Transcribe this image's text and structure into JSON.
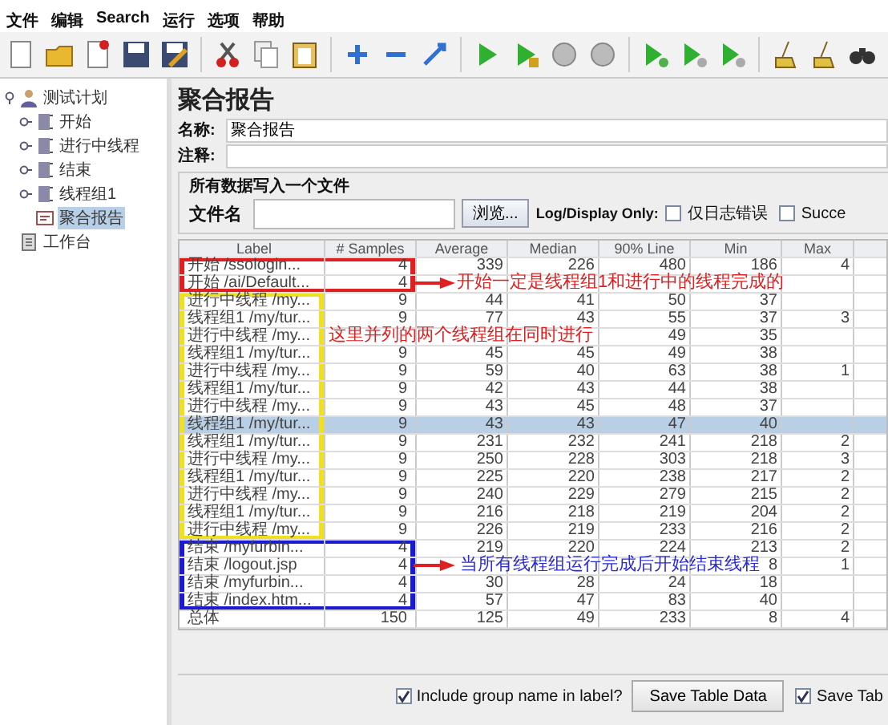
{
  "menu": [
    "文件",
    "编辑",
    "Search",
    "运行",
    "选项",
    "帮助"
  ],
  "tree": {
    "label": "测试计划",
    "expanded": true,
    "children": [
      {
        "label": "开始",
        "kind": "group",
        "selected": false
      },
      {
        "label": "进行中线程",
        "kind": "group",
        "selected": false
      },
      {
        "label": "结束",
        "kind": "group",
        "selected": false
      },
      {
        "label": "线程组1",
        "kind": "group",
        "selected": false
      },
      {
        "label": "聚合报告",
        "kind": "report",
        "selected": true
      }
    ]
  },
  "workbench": "工作台",
  "panel": {
    "title": "聚合报告",
    "name_label": "名称:",
    "name_value": "聚合报告",
    "comment_label": "注释:",
    "file_group": "所有数据写入一个文件",
    "file_label": "文件名",
    "browse": "浏览...",
    "log_label": "Log/Display Only:",
    "checks": [
      {
        "label": "仅日志错误",
        "checked": false
      },
      {
        "label": "Succe",
        "checked": false
      }
    ]
  },
  "table": {
    "columns": [
      "Label",
      "# Samples",
      "Average",
      "Median",
      "90% Line",
      "Min",
      "Max"
    ],
    "rows": [
      {
        "cells": [
          "开始 /ssologin...",
          "4",
          "339",
          "226",
          "480",
          "186",
          "4"
        ],
        "selected": false,
        "frame": {
          "color": "#e02020",
          "wide": true
        }
      },
      {
        "cells": [
          "开始 /ai/Default...",
          "4",
          null,
          null,
          null,
          null,
          null
        ],
        "selected": false,
        "frame": {
          "color": "#e02020",
          "wide": true
        }
      },
      {
        "cells": [
          "进行中线程 /my...",
          "9",
          "44",
          "41",
          "50",
          "37",
          null
        ],
        "selected": false,
        "frame": {
          "color": "#f0e020",
          "wide": false
        }
      },
      {
        "cells": [
          "线程组1 /my/tur...",
          "9",
          "77",
          "43",
          "55",
          "37",
          "3"
        ],
        "selected": false,
        "frame": {
          "color": "#f0e020",
          "wide": false
        }
      },
      {
        "cells": [
          "进行中线程 /my...",
          null,
          null,
          null,
          "49",
          "35",
          null
        ],
        "selected": false,
        "frame": {
          "color": "#f0e020",
          "wide": false
        }
      },
      {
        "cells": [
          "线程组1 /my/tur...",
          "9",
          "45",
          "45",
          "49",
          "38",
          null
        ],
        "selected": false,
        "frame": {
          "color": "#f0e020",
          "wide": false
        }
      },
      {
        "cells": [
          "进行中线程 /my...",
          "9",
          "59",
          "40",
          "63",
          "38",
          "1"
        ],
        "selected": false,
        "frame": {
          "color": "#f0e020",
          "wide": false
        }
      },
      {
        "cells": [
          "线程组1 /my/tur...",
          "9",
          "42",
          "43",
          "44",
          "38",
          null
        ],
        "selected": false,
        "frame": {
          "color": "#f0e020",
          "wide": false
        }
      },
      {
        "cells": [
          "进行中线程 /my...",
          "9",
          "43",
          "45",
          "48",
          "37",
          null
        ],
        "selected": false,
        "frame": {
          "color": "#f0e020",
          "wide": false
        }
      },
      {
        "cells": [
          "线程组1 /my/tur...",
          "9",
          "43",
          "43",
          "47",
          "40",
          null
        ],
        "selected": true,
        "frame": {
          "color": "#f0e020",
          "wide": false
        }
      },
      {
        "cells": [
          "线程组1 /my/tur...",
          "9",
          "231",
          "232",
          "241",
          "218",
          "2"
        ],
        "selected": false,
        "frame": {
          "color": "#f0e020",
          "wide": false
        }
      },
      {
        "cells": [
          "进行中线程 /my...",
          "9",
          "250",
          "228",
          "303",
          "218",
          "3"
        ],
        "selected": false,
        "frame": {
          "color": "#f0e020",
          "wide": false
        }
      },
      {
        "cells": [
          "线程组1 /my/tur...",
          "9",
          "225",
          "220",
          "238",
          "217",
          "2"
        ],
        "selected": false,
        "frame": {
          "color": "#f0e020",
          "wide": false
        }
      },
      {
        "cells": [
          "进行中线程 /my...",
          "9",
          "240",
          "229",
          "279",
          "215",
          "2"
        ],
        "selected": false,
        "frame": {
          "color": "#f0e020",
          "wide": false
        }
      },
      {
        "cells": [
          "线程组1 /my/tur...",
          "9",
          "216",
          "218",
          "219",
          "204",
          "2"
        ],
        "selected": false,
        "frame": {
          "color": "#f0e020",
          "wide": false
        }
      },
      {
        "cells": [
          "进行中线程 /my...",
          "9",
          "226",
          "219",
          "233",
          "216",
          "2"
        ],
        "selected": false,
        "frame": {
          "color": "#f0e020",
          "wide": false
        }
      },
      {
        "cells": [
          "结束 /myfurbin...",
          "4",
          "219",
          "220",
          "224",
          "213",
          "2"
        ],
        "selected": false,
        "frame": {
          "color": "#1a1ad0",
          "wide": true
        }
      },
      {
        "cells": [
          "结束 /logout.jsp",
          "4",
          null,
          null,
          null,
          "8",
          "1"
        ],
        "selected": false,
        "frame": {
          "color": "#1a1ad0",
          "wide": true
        }
      },
      {
        "cells": [
          "结束 /myfurbin...",
          "4",
          "30",
          "28",
          "24",
          "18",
          null
        ],
        "selected": false,
        "frame": {
          "color": "#1a1ad0",
          "wide": true
        }
      },
      {
        "cells": [
          "结束 /index.htm...",
          "4",
          "57",
          "47",
          "83",
          "40",
          null
        ],
        "selected": false,
        "frame": {
          "color": "#1a1ad0",
          "wide": true
        }
      },
      {
        "cells": [
          "总体",
          "150",
          "125",
          "49",
          "233",
          "8",
          "4"
        ],
        "selected": false
      }
    ]
  },
  "bottom": {
    "include_group": {
      "label": "Include group name in label?",
      "checked": true
    },
    "save_button": "Save Table Data",
    "save_check": {
      "label": "Save Tab",
      "checked": true
    }
  },
  "annotations": [
    {
      "kind": "arrow",
      "color": "#e02020"
    },
    {
      "kind": "note",
      "color": "#e02020",
      "text": "开始一定是线程组1和进行中的线程完成的"
    },
    {
      "kind": "note",
      "color": "#e02020",
      "text": "这里并列的两个线程组在同时进行"
    },
    {
      "kind": "arrow",
      "color": "#e02020"
    },
    {
      "kind": "note",
      "color": "#2a2ad8",
      "text": "当所有线程组运行完成后开始结束线程"
    }
  ]
}
